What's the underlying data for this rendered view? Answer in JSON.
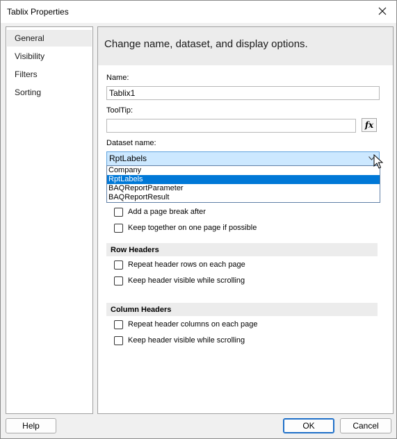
{
  "window": {
    "title": "Tablix Properties"
  },
  "nav": {
    "items": [
      {
        "label": "General"
      },
      {
        "label": "Visibility"
      },
      {
        "label": "Filters"
      },
      {
        "label": "Sorting"
      }
    ]
  },
  "header": {
    "text": "Change name, dataset, and display options."
  },
  "form": {
    "name_label": "Name:",
    "name_value": "Tablix1",
    "tooltip_label": "ToolTip:",
    "tooltip_value": "",
    "fx_label": "fx",
    "dataset_label": "Dataset name:",
    "dataset_value": "RptLabels",
    "dataset_options": [
      "Company",
      "RptLabels",
      "BAQReportParameter",
      "BAQReportResult"
    ]
  },
  "page_break": {
    "add_after": "Add a page break after",
    "keep_together": "Keep together on one page if possible"
  },
  "row_headers": {
    "title": "Row Headers",
    "repeat": "Repeat header rows on each page",
    "keep_visible": "Keep header visible while scrolling"
  },
  "column_headers": {
    "title": "Column Headers",
    "repeat": "Repeat header columns on each page",
    "keep_visible": "Keep header visible while scrolling"
  },
  "buttons": {
    "help": "Help",
    "ok": "OK",
    "cancel": "Cancel"
  },
  "colors": {
    "selection": "#0078d7",
    "combo_bg": "#cce8ff",
    "section_bg": "#ececec"
  }
}
